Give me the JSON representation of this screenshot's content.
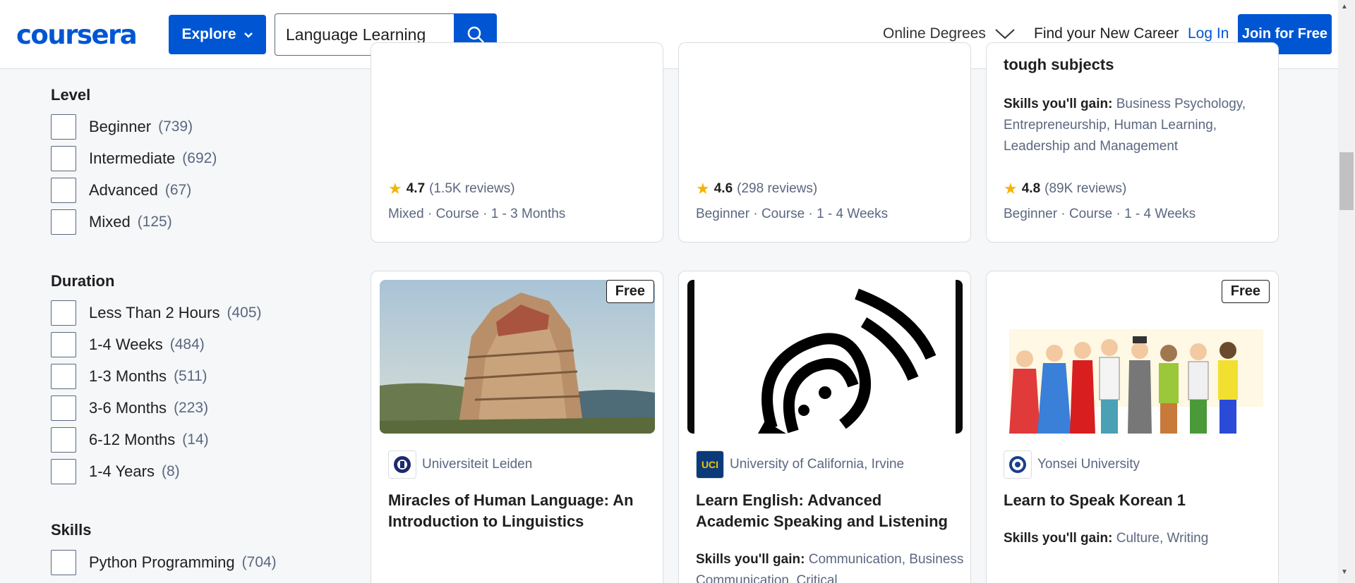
{
  "header": {
    "logo": "coursera",
    "explore_label": "Explore",
    "search_value": "Language Learning",
    "nav_degrees": "Online Degrees",
    "nav_career": "Find your New Career",
    "nav_login": "Log In",
    "join_label": "Join for Free"
  },
  "filters": {
    "level": {
      "title": "Level",
      "options": [
        {
          "label": "Beginner",
          "count": "(739)"
        },
        {
          "label": "Intermediate",
          "count": "(692)"
        },
        {
          "label": "Advanced",
          "count": "(67)"
        },
        {
          "label": "Mixed",
          "count": "(125)"
        }
      ]
    },
    "duration": {
      "title": "Duration",
      "options": [
        {
          "label": "Less Than 2 Hours",
          "count": "(405)"
        },
        {
          "label": "1-4 Weeks",
          "count": "(484)"
        },
        {
          "label": "1-3 Months",
          "count": "(511)"
        },
        {
          "label": "3-6 Months",
          "count": "(223)"
        },
        {
          "label": "6-12 Months",
          "count": "(14)"
        },
        {
          "label": "1-4 Years",
          "count": "(8)"
        }
      ]
    },
    "skills": {
      "title": "Skills",
      "options": [
        {
          "label": "Python Programming",
          "count": "(704)"
        }
      ]
    }
  },
  "top_cards": [
    {
      "rating": "4.7",
      "reviews": "(1.5K reviews)",
      "info": "Mixed · Course · 1 - 3 Months"
    },
    {
      "rating": "4.6",
      "reviews": "(298 reviews)",
      "info": "Beginner · Course · 1 - 4 Weeks"
    },
    {
      "title_fragment": "tough subjects",
      "skills_label": "Skills you'll gain:",
      "skills": "Business Psychology, Entrepreneurship, Human Learning, Leadership and Management",
      "rating": "4.8",
      "reviews": "(89K reviews)",
      "info": "Beginner · Course · 1 - 4 Weeks"
    }
  ],
  "bottom_cards": [
    {
      "badge": "Free",
      "partner_logo_text": "",
      "partner": "Universiteit Leiden",
      "title": "Miracles of Human Language: An Introduction to Linguistics"
    },
    {
      "badge": "",
      "partner_logo_text": "UCI",
      "partner": "University of California, Irvine",
      "title": "Learn English: Advanced Academic Speaking and Listening",
      "skills_label": "Skills you'll gain:",
      "skills": "Communication, Business Communication, Critical"
    },
    {
      "badge": "Free",
      "partner_logo_text": "",
      "partner": "Yonsei University",
      "title": "Learn to Speak Korean 1",
      "skills_label": "Skills you'll gain:",
      "skills": "Culture, Writing"
    }
  ],
  "colors": {
    "brand": "#0056d2",
    "star": "#f5b400"
  }
}
